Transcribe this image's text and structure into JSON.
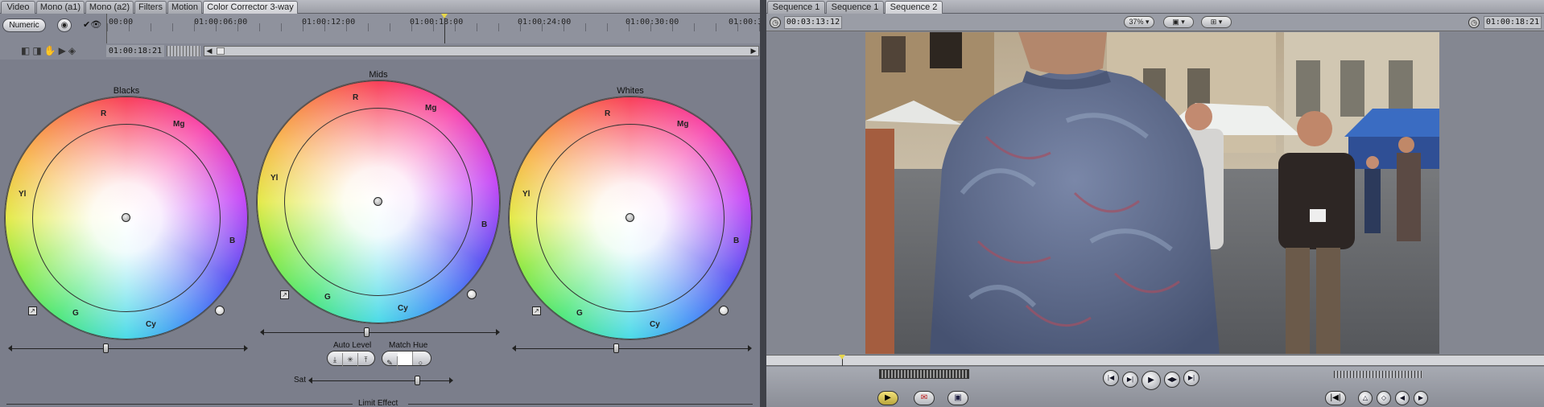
{
  "left_panel": {
    "tabs": [
      "Video",
      "Mono (a1)",
      "Mono (a2)",
      "Filters",
      "Motion",
      "Color Corrector 3-way"
    ],
    "active_tab": "Color Corrector 3-way",
    "numeric_button": "Numeric",
    "ruler_timecodes": [
      "00:00",
      "01:00:06:00",
      "01:00:12:00",
      "01:00:18:00",
      "01:00:24:00",
      "01:00:30:00",
      "01:00:3"
    ],
    "current_timecode": "01:00:18:21",
    "wheels": [
      {
        "title": "Blacks",
        "labels": {
          "r": "R",
          "mg": "Mg",
          "yl": "Yl",
          "b": "B",
          "g": "G",
          "cy": "Cy"
        }
      },
      {
        "title": "Mids",
        "labels": {
          "r": "R",
          "mg": "Mg",
          "yl": "Yl",
          "b": "B",
          "g": "G",
          "cy": "Cy"
        }
      },
      {
        "title": "Whites",
        "labels": {
          "r": "R",
          "mg": "Mg",
          "yl": "Yl",
          "b": "B",
          "g": "G",
          "cy": "Cy"
        }
      }
    ],
    "auto_level_label": "Auto Level",
    "match_hue_label": "Match Hue",
    "sat_label": "Sat",
    "limit_effect_label": "Limit Effect"
  },
  "right_panel": {
    "tabs": [
      "Sequence 1",
      "Sequence 1",
      "Sequence 2"
    ],
    "active_tab": "Sequence 2",
    "duration_timecode": "00:03:13:12",
    "zoom": "37%",
    "current_timecode": "01:00:18:21"
  },
  "colors": {
    "panel_bg": "#7b7e8b",
    "playhead": "#e6d64a"
  }
}
